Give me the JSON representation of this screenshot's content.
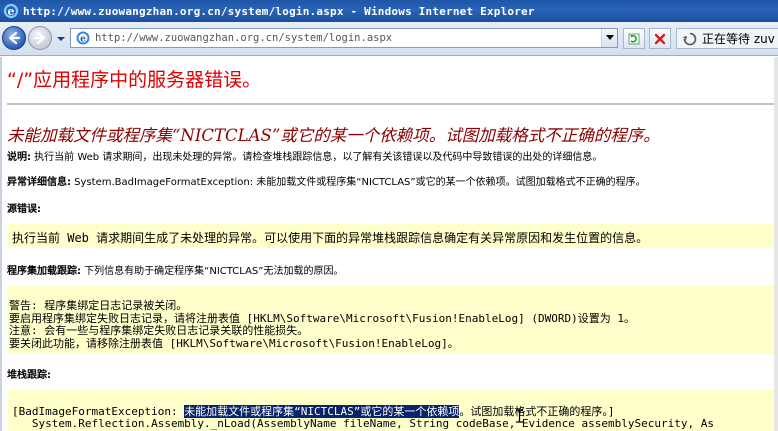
{
  "window": {
    "title": "http://www.zuowangzhan.org.cn/system/login.aspx - Windows Internet Explorer"
  },
  "navigation": {
    "address_url": "http://www.zuowangzhan.org.cn/system/login.aspx",
    "status_text": "正在等待 zuv",
    "icons": {
      "back": "back-arrow-icon",
      "forward": "forward-arrow-icon",
      "refresh": "refresh-icon",
      "stop": "stop-icon",
      "loading": "loading-spinner-icon"
    }
  },
  "page": {
    "heading": "“/”应用程序中的服务器错误。",
    "subheading": "未能加载文件或程序集“NICTCLAS”或它的某一个依赖项。试图加载格式不正确的程序。",
    "description_label": "说明:",
    "description_text": " 执行当前 Web 请求期间，出现未处理的异常。请检查堆栈跟踪信息，以了解有关该错误以及代码中导致错误的出处的详细信息。",
    "exception_label": "异常详细信息:",
    "exception_text": " System.BadImageFormatException: 未能加载文件或程序集“NICTCLAS”或它的某一个依赖项。试图加载格式不正确的程序。",
    "source_error_label": "源错误:",
    "source_error_box": "执行当前 Web 请求期间生成了未处理的异常。可以使用下面的异常堆栈跟踪信息确定有关异常原因和发生位置的信息。",
    "assembly_trace_label": "程序集加载跟踪:",
    "assembly_trace_text": " 下列信息有助于确定程序集“NICTCLAS”无法加载的原因。",
    "assembly_trace_box": [
      "警告: 程序集绑定日志记录被关闭。",
      "要启用程序集绑定失败日志记录，请将注册表值 [HKLM\\Software\\Microsoft\\Fusion!EnableLog] (DWORD)设置为 1。",
      "注意: 会有一些与程序集绑定失败日志记录关联的性能损失。",
      "要关闭此功能，请移除注册表值 [HKLM\\Software\\Microsoft\\Fusion!EnableLog]。"
    ],
    "stack_trace_label": "堆栈跟踪:",
    "stack_trace_prefix": "[BadImageFormatException: ",
    "stack_trace_selected": "未能加载文件或程序集“NICTCLAS”或它的某一个依赖项",
    "stack_trace_suffix": "。试图加载格式不正确的程序。]",
    "stack_trace_line2": "   System.Reflection.Assembly._nLoad(AssemblyName fileName, String codeBase, Evidence assemblySecurity, As"
  },
  "colors": {
    "heading": "#e00000",
    "subheading": "#8b0000",
    "code_box": "#ffffcc",
    "selection": "#0a246a"
  }
}
